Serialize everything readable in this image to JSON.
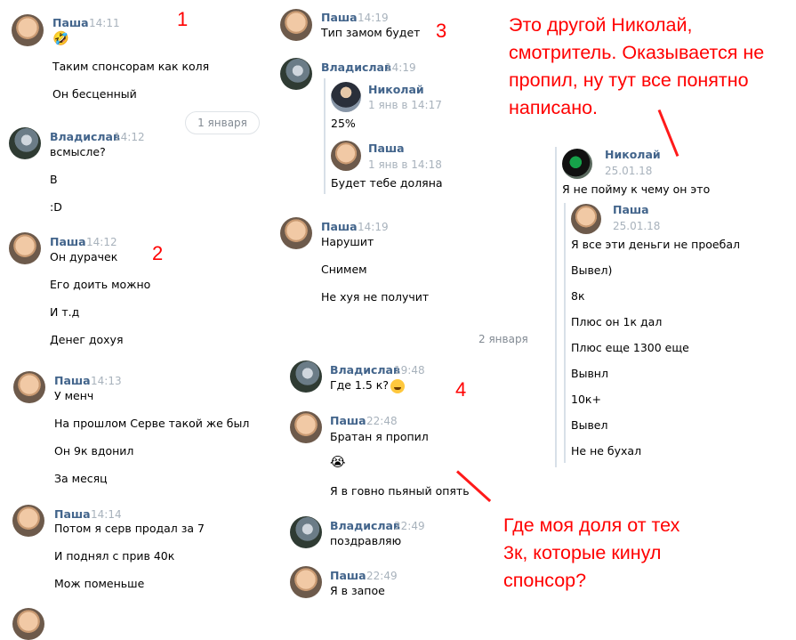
{
  "col1": {
    "m1": {
      "author": "Паша",
      "time": "14:11",
      "lines": [
        "Таким спонсорам как коля",
        "Он бесценный"
      ]
    },
    "date1": "1 января",
    "m2": {
      "author": "Владислав",
      "time": "14:12",
      "lines": [
        "всмысле?",
        "В",
        ":D"
      ]
    },
    "m3": {
      "author": "Паша",
      "time": "14:12",
      "lines": [
        "Он дурачек",
        "Его доить можно",
        "И т.д",
        "Денег дохуя"
      ]
    },
    "m4": {
      "author": "Паша",
      "time": "14:13",
      "lines": [
        "У менч",
        "На прошлом Серве такой же был",
        "Он 9к вдонил",
        "За месяц"
      ]
    },
    "m5": {
      "author": "Паша",
      "time": "14:14",
      "lines": [
        "Потом я серв продал за 7",
        "И поднял с прив 40к",
        "Мож поменьше"
      ]
    }
  },
  "col2": {
    "m1": {
      "author": "Паша",
      "time": "14:19",
      "lines": [
        "Тип замом будет"
      ]
    },
    "m2": {
      "author": "Владислав",
      "time": "14:19",
      "q1": {
        "author": "Николай",
        "time": "1 янв в 14:17",
        "text": "25%"
      },
      "q2": {
        "author": "Паша",
        "time": "1 янв в 14:18",
        "text": "Будет тебе доляна"
      }
    },
    "m3": {
      "author": "Паша",
      "time": "14:19",
      "lines": [
        "Нарушит",
        "Снимем",
        "Не хуя не получит"
      ]
    },
    "date2": "2 января",
    "m4": {
      "author": "Владислав",
      "time": "19:48",
      "text": "Где 1.5 к?"
    },
    "m5": {
      "author": "Паша",
      "time": "22:48",
      "lines": [
        "Братан я пропил",
        "Я в говно пьяный опять"
      ]
    },
    "m6": {
      "author": "Владислав",
      "time": "22:49",
      "text": "поздравляю"
    },
    "m7": {
      "author": "Паша",
      "time": "22:49",
      "text": "Я в запое"
    }
  },
  "col3": {
    "nik": {
      "author": "Николай",
      "date": "25.01.18",
      "text": "Я не пойму к чему он это"
    },
    "pasha": {
      "author": "Паша",
      "date": "25.01.18",
      "lines": [
        "Я все эти деньги не проебал",
        "Вывел)",
        "8к",
        "Плюс он 1к дал",
        "Плюс еще 1300 еще",
        "Вывнл",
        "10к+",
        "Вывел",
        "Не не бухал"
      ]
    }
  },
  "annotations": {
    "n1": "1",
    "n2": "2",
    "n3": "3",
    "n4": "4",
    "note_top": "Это другой Николай, смотритель. Оказывается не пропил, ну тут все понятно написано.",
    "note_bottom": "Где моя доля от тех 3к, которые кинул спонсор?"
  },
  "colors": {
    "name": "#42648b",
    "time": "#a8b2bc",
    "annotation": "#ff0000"
  }
}
